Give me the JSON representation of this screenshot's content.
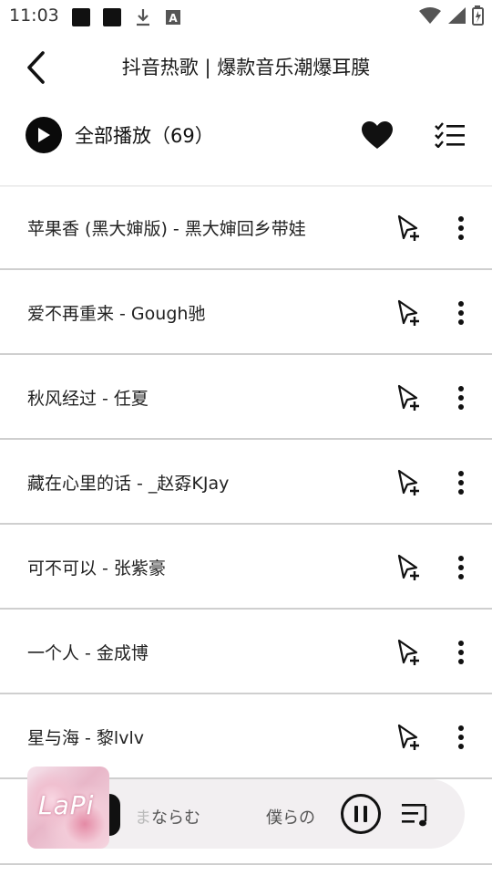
{
  "status_bar": {
    "time": "11:03",
    "icons": [
      "notification-square-icon",
      "notification-square-icon",
      "download-icon",
      "font-a-icon",
      "wifi-icon",
      "signal-icon",
      "battery-icon"
    ]
  },
  "header": {
    "title": "抖音热歌 | 爆款音乐潮爆耳膜",
    "back_icon": "chevron-left-icon"
  },
  "actions": {
    "play_all_label": "全部播放（69）",
    "play_icon": "play-icon",
    "favorite_icon": "heart-icon",
    "multi_select_icon": "checklist-icon"
  },
  "songs": [
    {
      "title": "苹果香 (黑大婶版) - 黑大婶回乡带娃"
    },
    {
      "title": "爱不再重来 - Gough驰"
    },
    {
      "title": "秋风经过 - 任夏"
    },
    {
      "title": "藏在心里的话 - _赵孬KJay"
    },
    {
      "title": "可不可以 - 张紫豪"
    },
    {
      "title": "一个人 - 金成博"
    },
    {
      "title": "星与海 - 黎lvlv"
    }
  ],
  "player": {
    "album_text": "LaPi",
    "lyric_a_faded": "ま",
    "lyric_a": "ならむ",
    "lyric_b": "僕らの",
    "lyric_b_faded": "",
    "pause_icon": "pause-icon",
    "playlist_icon": "playlist-icon"
  }
}
